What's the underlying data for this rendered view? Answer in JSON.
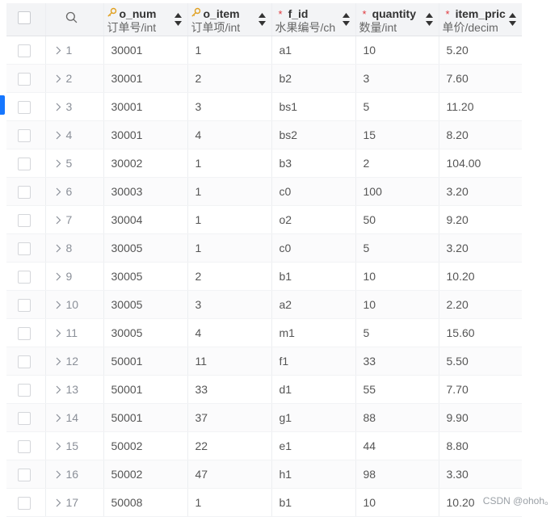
{
  "columns": [
    {
      "name": "o_num",
      "type": "订单号/int",
      "marker": "key"
    },
    {
      "name": "o_item",
      "type": "订单项/int",
      "marker": "key"
    },
    {
      "name": "f_id",
      "type": "水果编号/ch",
      "marker": "required"
    },
    {
      "name": "quantity",
      "type": "数量/int",
      "marker": "required"
    },
    {
      "name": "item_pric",
      "type": "单价/decim",
      "marker": "required"
    }
  ],
  "rows": [
    {
      "index": "1",
      "o_num": "30001",
      "o_item": "1",
      "f_id": "a1",
      "quantity": "10",
      "item_price": "5.20"
    },
    {
      "index": "2",
      "o_num": "30001",
      "o_item": "2",
      "f_id": "b2",
      "quantity": "3",
      "item_price": "7.60"
    },
    {
      "index": "3",
      "o_num": "30001",
      "o_item": "3",
      "f_id": "bs1",
      "quantity": "5",
      "item_price": "11.20"
    },
    {
      "index": "4",
      "o_num": "30001",
      "o_item": "4",
      "f_id": "bs2",
      "quantity": "15",
      "item_price": "8.20"
    },
    {
      "index": "5",
      "o_num": "30002",
      "o_item": "1",
      "f_id": "b3",
      "quantity": "2",
      "item_price": "104.00"
    },
    {
      "index": "6",
      "o_num": "30003",
      "o_item": "1",
      "f_id": "c0",
      "quantity": "100",
      "item_price": "3.20"
    },
    {
      "index": "7",
      "o_num": "30004",
      "o_item": "1",
      "f_id": "o2",
      "quantity": "50",
      "item_price": "9.20"
    },
    {
      "index": "8",
      "o_num": "30005",
      "o_item": "1",
      "f_id": "c0",
      "quantity": "5",
      "item_price": "3.20"
    },
    {
      "index": "9",
      "o_num": "30005",
      "o_item": "2",
      "f_id": "b1",
      "quantity": "10",
      "item_price": "10.20"
    },
    {
      "index": "10",
      "o_num": "30005",
      "o_item": "3",
      "f_id": "a2",
      "quantity": "10",
      "item_price": "2.20"
    },
    {
      "index": "11",
      "o_num": "30005",
      "o_item": "4",
      "f_id": "m1",
      "quantity": "5",
      "item_price": "15.60"
    },
    {
      "index": "12",
      "o_num": "50001",
      "o_item": "11",
      "f_id": "f1",
      "quantity": "33",
      "item_price": "5.50"
    },
    {
      "index": "13",
      "o_num": "50001",
      "o_item": "33",
      "f_id": "d1",
      "quantity": "55",
      "item_price": "7.70"
    },
    {
      "index": "14",
      "o_num": "50001",
      "o_item": "37",
      "f_id": "g1",
      "quantity": "88",
      "item_price": "9.90"
    },
    {
      "index": "15",
      "o_num": "50002",
      "o_item": "22",
      "f_id": "e1",
      "quantity": "44",
      "item_price": "8.80"
    },
    {
      "index": "16",
      "o_num": "50002",
      "o_item": "47",
      "f_id": "h1",
      "quantity": "98",
      "item_price": "3.30"
    },
    {
      "index": "17",
      "o_num": "50008",
      "o_item": "1",
      "f_id": "b1",
      "quantity": "10",
      "item_price": "10.20"
    }
  ],
  "watermark": "CSDN @ohoh。",
  "icons": {
    "search": "search-icon",
    "key": "key-icon",
    "sort": "sort-icon",
    "expand": "chevron-right-icon"
  },
  "colors": {
    "key": "#e0a020",
    "required": "#e0383e",
    "header_bg": "#f3f4f6",
    "accent": "#1677ff"
  }
}
